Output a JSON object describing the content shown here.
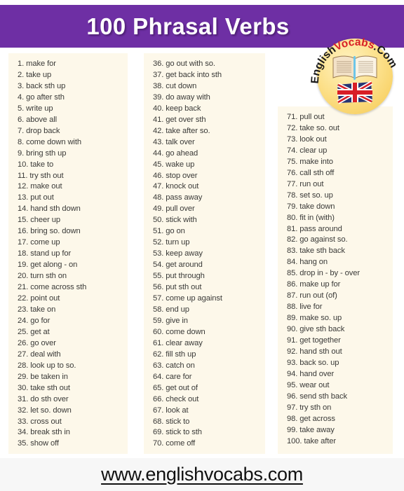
{
  "header": {
    "title": "100 Phrasal Verbs",
    "background_color": "#6E2FA4",
    "title_color": "#FFFFFF"
  },
  "logo": {
    "name": "englishvocabs-badge",
    "text_part_1": "English",
    "text_part_2": "Vocabs",
    "text_part_3": ".Com",
    "color_part_1": "#1A1A1A",
    "color_part_2": "#D81E26",
    "color_part_3": "#1A1A1A",
    "badge_color": "#F5C84F",
    "book_icon": "open-book-icon",
    "flag_icon": "uk-flag-icon"
  },
  "columns": [
    {
      "id": "column-1",
      "background_color": "#FDF8EA",
      "items": [
        "1. make  for",
        "2. take up",
        "3. back sth up",
        "4. go after  sth",
        "5. write up",
        "6. above all",
        "7. drop back",
        "8. come  down with",
        "9. bring sth  up",
        "10. take to",
        "11. try sth  out",
        "12. make  out",
        "13. put out",
        "14. hand sth down",
        "15. cheer up",
        "16. bring so.  down",
        "17. come  up",
        "18. stand up for",
        "19. get along - on",
        "20. turn sth on",
        "21. come  across sth",
        "22. point out",
        "23. take on",
        "24. go for",
        "25. get at",
        "26. go over",
        "27. deal with",
        "28. look up to so.",
        "29. be taken in",
        "30. take sth  out",
        "31. do sth over",
        "32. let so. down",
        "33. cross out",
        "34. break sth  in",
        "35. show off"
      ]
    },
    {
      "id": "column-2",
      "background_color": "#FDF8EA",
      "items": [
        "36. go out with so.",
        "37. get back into sth",
        "38. cut down",
        "39. do away with",
        "40. keep back",
        "41. get over sth",
        "42. take after  so.",
        "43. talk  over",
        "44. go ahead",
        "45. wake up",
        "46. stop over",
        "47. knock out",
        "48. pass away",
        "49. pull over",
        "50. stick  with",
        "51. go on",
        "52. turn up",
        "53. keep away",
        "54. get around",
        "55. put through",
        "56. put sth out",
        "57. come  up against",
        "58. end up",
        "59. give in",
        "60. come down",
        "61. clear away",
        "62. fill  sth  up",
        "63. catch  on",
        "64. care for",
        "65. get out of",
        "66. check out",
        "67. look  at",
        "68. stick  to",
        "69. stick  to sth",
        "70. come  off"
      ]
    },
    {
      "id": "column-3",
      "background_color": "#FDF8EA",
      "items": [
        "71. pull out",
        "72. take so. out",
        "73. look out",
        "74. clear up",
        "75. make  into",
        "76. call sth  off",
        "77. run out",
        "78. set so.  up",
        "79. take down",
        "80. fit in (with)",
        "81. pass around",
        "82. go against so.",
        "83. take sth  back",
        "84. hang on",
        "85. drop in - by - over",
        "86. make  up for",
        "87. run out (of)",
        "88. live for",
        "89. make  so. up",
        "90. give sth back",
        "91. get together",
        "92. hand sth out",
        "93. back so. up",
        "94. hand over",
        "95. wear out",
        "96. send sth  back",
        "97. try sth  on",
        "98. get across",
        "99. take  away",
        "100. take after"
      ]
    }
  ],
  "footer": {
    "url": "www.englishvocabs.com",
    "background_color": "#F7F7F7"
  }
}
